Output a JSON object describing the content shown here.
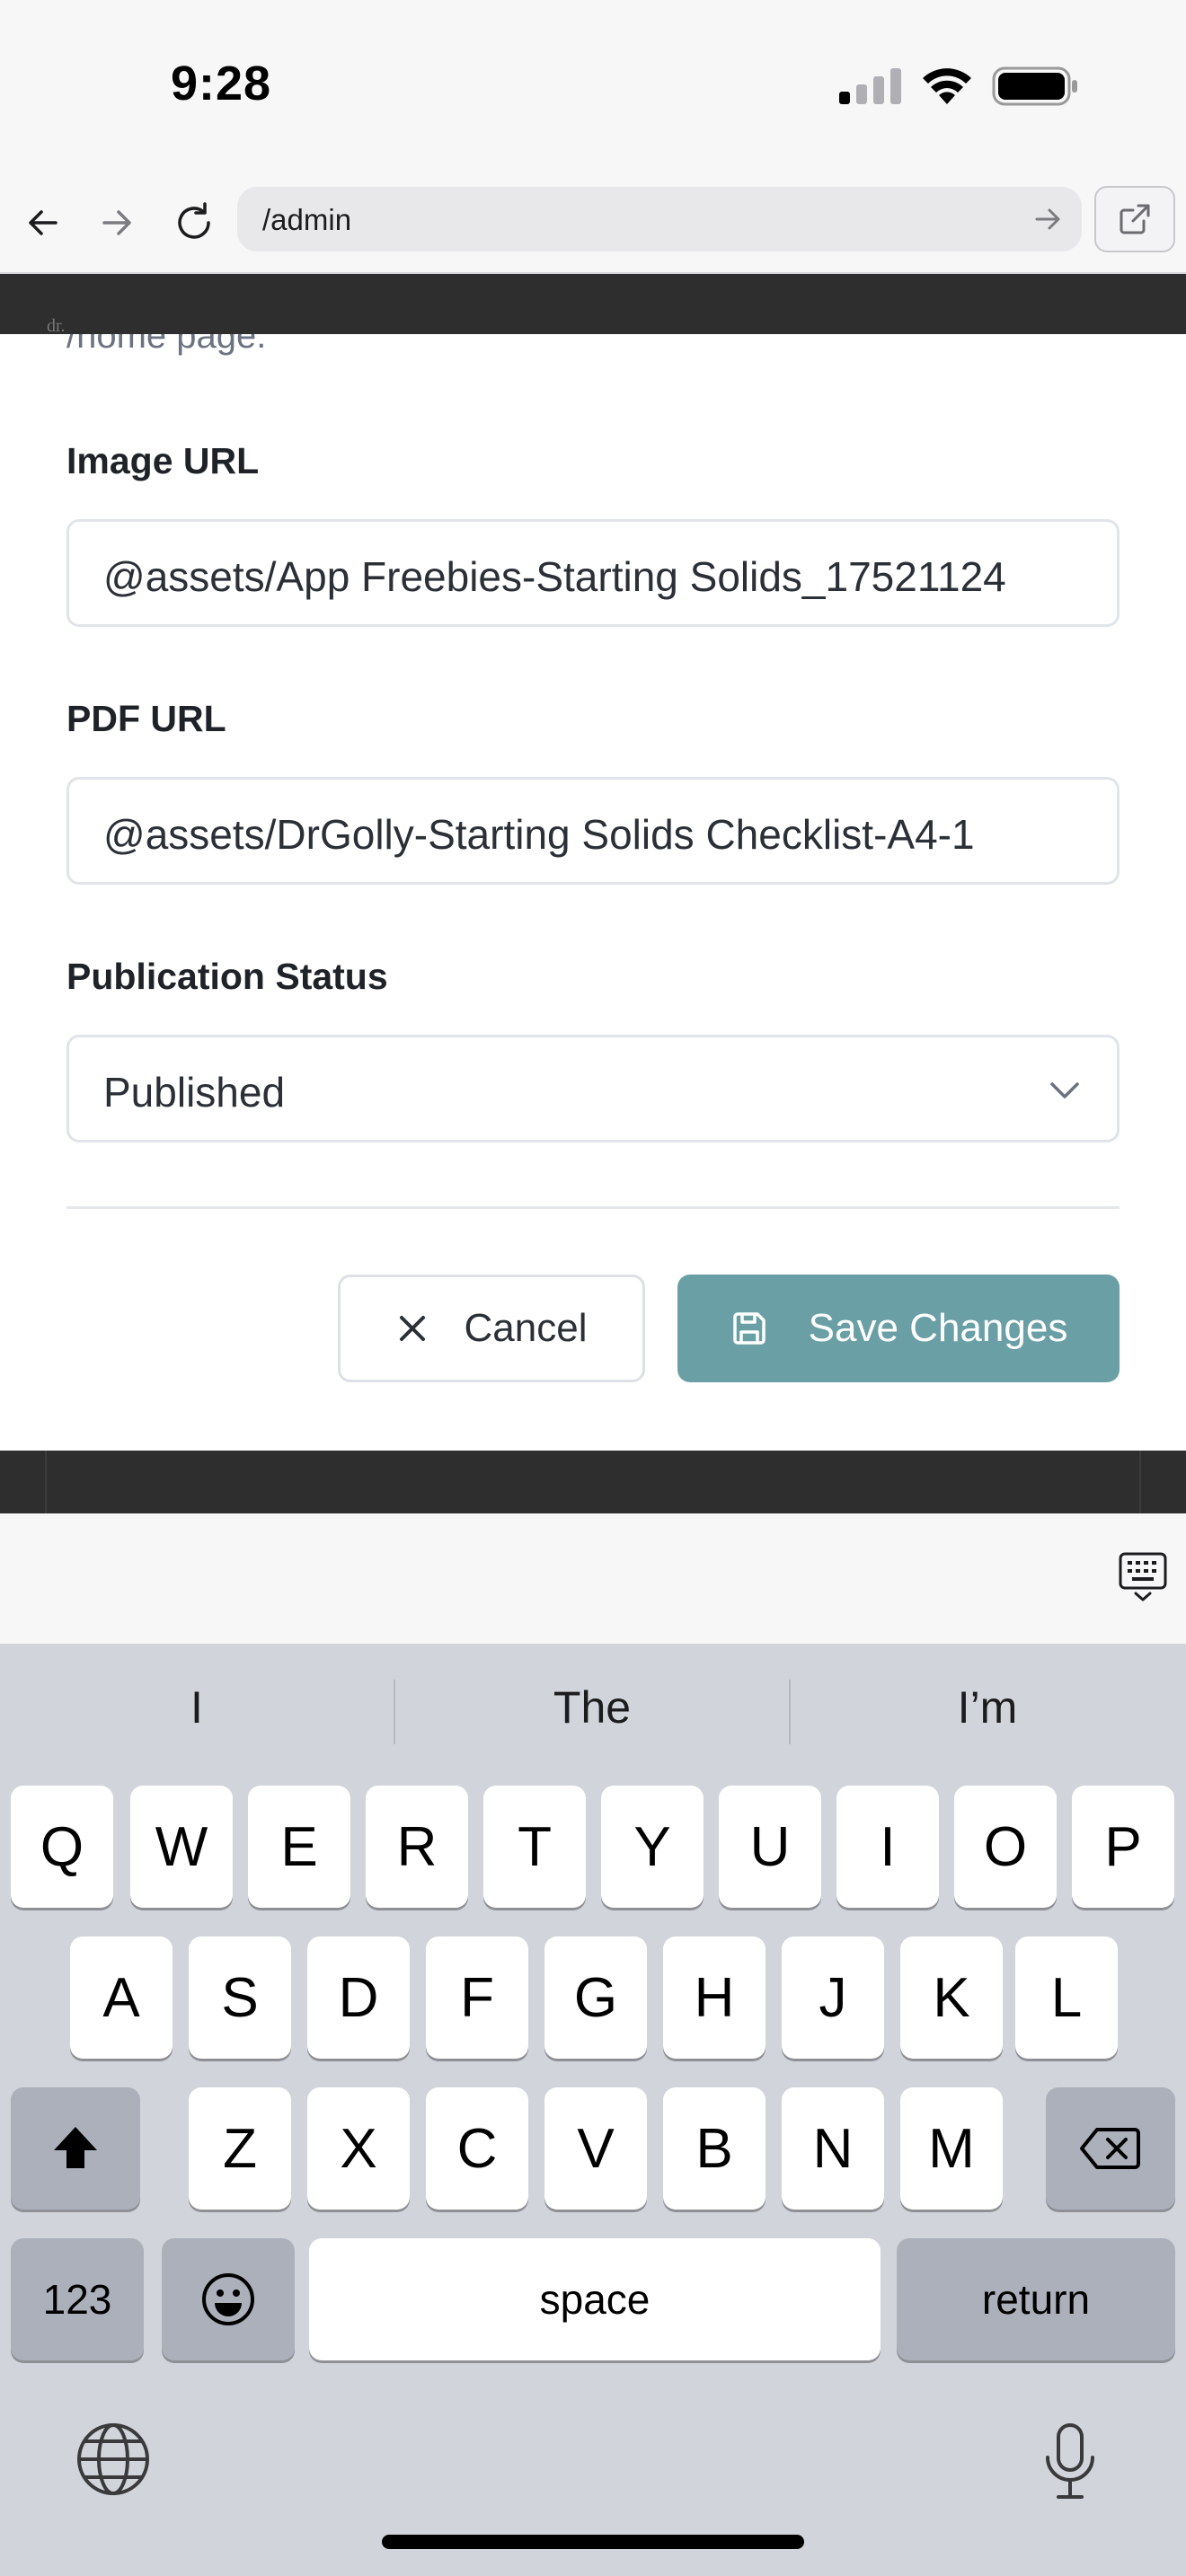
{
  "status": {
    "time": "9:28"
  },
  "browser": {
    "url": "/admin"
  },
  "modal": {
    "cut_text": "/home page.",
    "fields": [
      {
        "label": "Image URL",
        "value": "@assets/App Freebies-Starting Solids_17521124"
      },
      {
        "label": "PDF URL",
        "value": "@assets/DrGolly-Starting Solids Checklist-A4-1"
      },
      {
        "label": "Publication Status",
        "value": "Published"
      }
    ],
    "cancel_label": "Cancel",
    "save_label": "Save Changes",
    "save_color": "#6aa0a5"
  },
  "backdrop": {
    "logo_text": "dr."
  },
  "keyboard": {
    "suggestions": [
      "I",
      "The",
      "I’m"
    ],
    "rows": [
      [
        "Q",
        "W",
        "E",
        "R",
        "T",
        "Y",
        "U",
        "I",
        "O",
        "P"
      ],
      [
        "A",
        "S",
        "D",
        "F",
        "G",
        "H",
        "J",
        "K",
        "L"
      ],
      [
        "Z",
        "X",
        "C",
        "V",
        "B",
        "N",
        "M"
      ]
    ],
    "numbers_label": "123",
    "space_label": "space",
    "return_label": "return"
  }
}
